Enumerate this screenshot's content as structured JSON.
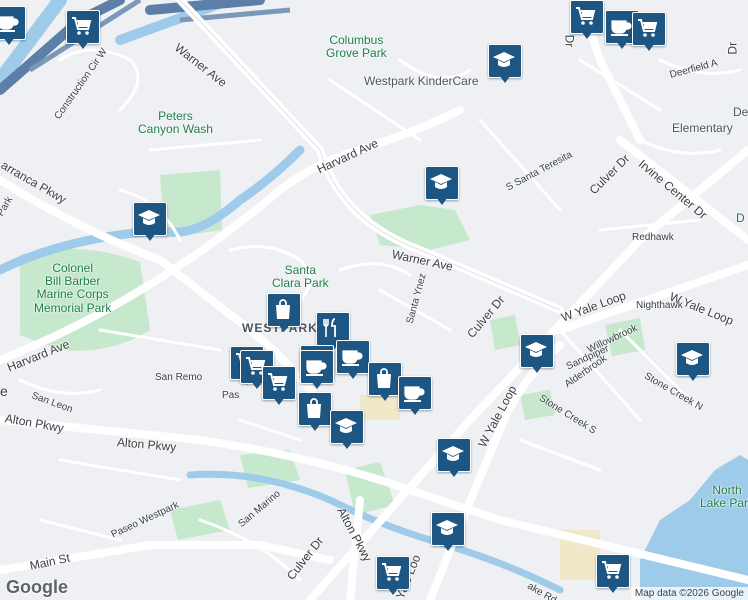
{
  "map": {
    "roads": {
      "warner_ave_nw": "Warner Ave",
      "warner_ave_east": "Warner Ave",
      "harvard_ave_north": "Harvard Ave",
      "harvard_ave_south": "Harvard Ave",
      "alton_pkwy": "Alton Pkwy",
      "alton_pkwy_2": "Alton Pkwy",
      "culver_dr_south": "Culver Dr",
      "culver_dr_mid": "Culver Dr",
      "culver_dr_north": "Culver Dr",
      "w_yale_loop_east": "W Yale Loop",
      "w_yale_loop_mid": "W Yale Loop",
      "w_yale_loop_south": "W Yale Loop",
      "yale_loop_bottom": "Yale Loo",
      "irvine_center_dr": "Irvine Center Dr",
      "barranca_pkwy": "arranca Pkwy",
      "main_st": "Main St",
      "construction_cir": "Construction Cir W",
      "s_santa_teresita": "S Santa Teresita",
      "santa_ynez": "Santa Ynez",
      "redhawk": "Redhawk",
      "nighthawk": "Nighthawk",
      "willowbrook": "Willowbrook",
      "sandpiper": "Sandpiper",
      "alderbrook": "Alderbrook",
      "stone_creek_s": "Stone Creek S",
      "stone_creek_n": "Stone Creek N",
      "deerfield": "Deerfield A",
      "san_remo": "San Remo",
      "san_leon": "San Leon",
      "san_marino": "San Marino",
      "paseo_westpark": "Paseo Westpark",
      "pas_fragment": "Pas",
      "park_fragment": "Park",
      "ake_rd": "ake Rd",
      "dr_fragment": "Dr",
      "left_edge_e": "e",
      "right_dr": "Dr",
      "right_d": "D"
    },
    "places": {
      "columbus_grove_park": "Columbus\nGrove Park",
      "peters_canyon_wash": "Peters\nCanyon Wash",
      "colonel_bill_barber": "Colonel\nBill Barber\nMarine Corps\nMemorial Park",
      "santa_clara_park": "Santa\nClara Park",
      "north_lake_park": "North\nLake Park",
      "westpark_kindercare": "Westpark KinderCare",
      "westpark_area": "WESTPARK",
      "elementary": "Elementary",
      "de_fragment": "De"
    },
    "markers": [
      {
        "icon": "coffee-icon"
      },
      {
        "icon": "shopping-cart-icon"
      },
      {
        "icon": "shopping-cart-icon"
      },
      {
        "icon": "coffee-icon"
      },
      {
        "icon": "shopping-cart-icon"
      },
      {
        "icon": "school-icon"
      },
      {
        "icon": "school-icon"
      },
      {
        "icon": "school-icon"
      },
      {
        "icon": "shopping-bag-icon"
      },
      {
        "icon": "restaurant-icon"
      },
      {
        "icon": "shopping-cart-icon"
      },
      {
        "icon": "shopping-cart-icon"
      },
      {
        "icon": "coffee-icon"
      },
      {
        "icon": "coffee-icon"
      },
      {
        "icon": "shopping-bag-icon"
      },
      {
        "icon": "coffee-icon"
      },
      {
        "icon": "shopping-cart-icon"
      },
      {
        "icon": "shopping-bag-icon"
      },
      {
        "icon": "school-icon"
      },
      {
        "icon": "coffee-icon"
      },
      {
        "icon": "school-icon"
      },
      {
        "icon": "school-icon"
      },
      {
        "icon": "school-icon"
      },
      {
        "icon": "school-icon"
      },
      {
        "icon": "shopping-cart-icon"
      },
      {
        "icon": "shopping-cart-icon"
      }
    ],
    "marker_color": "#1d5683",
    "water_color": "#9ecbe9",
    "park_color": "#c6e8cc",
    "road_color": "#ffffff"
  },
  "footer": {
    "logo": "Google",
    "attribution": "Map data ©2026 Google"
  }
}
